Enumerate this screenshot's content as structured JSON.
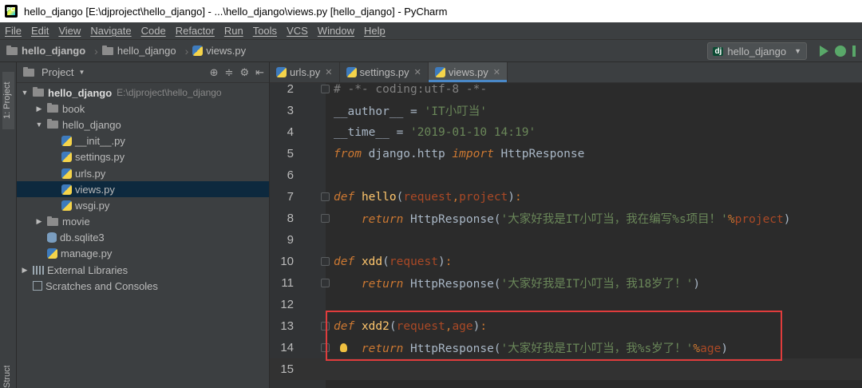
{
  "window": {
    "title": "hello_django [E:\\djproject\\hello_django] - ...\\hello_django\\views.py [hello_django] - PyCharm"
  },
  "menu": [
    "File",
    "Edit",
    "View",
    "Navigate",
    "Code",
    "Refactor",
    "Run",
    "Tools",
    "VCS",
    "Window",
    "Help"
  ],
  "breadcrumb": [
    "hello_django",
    "hello_django",
    "views.py"
  ],
  "run_config": {
    "label": "hello_django"
  },
  "toolwindows": {
    "project_tab": "1: Project",
    "structure_tab": "Structure"
  },
  "project_panel": {
    "title": "Project",
    "tree": [
      {
        "label": "hello_django",
        "hint": "E:\\djproject\\hello_django",
        "icon": "folder-icon",
        "arrow": "▼",
        "indent": 0,
        "bold": true
      },
      {
        "label": "book",
        "icon": "folder-icon",
        "arrow": "▶",
        "indent": 1
      },
      {
        "label": "hello_django",
        "icon": "folder-icon",
        "arrow": "▼",
        "indent": 1
      },
      {
        "label": "__init__.py",
        "icon": "python-file-icon",
        "arrow": "",
        "indent": 2
      },
      {
        "label": "settings.py",
        "icon": "python-file-icon",
        "arrow": "",
        "indent": 2
      },
      {
        "label": "urls.py",
        "icon": "python-file-icon",
        "arrow": "",
        "indent": 2
      },
      {
        "label": "views.py",
        "icon": "python-file-icon",
        "arrow": "",
        "indent": 2,
        "selected": true
      },
      {
        "label": "wsgi.py",
        "icon": "python-file-icon",
        "arrow": "",
        "indent": 2
      },
      {
        "label": "movie",
        "icon": "folder-icon",
        "arrow": "▶",
        "indent": 1
      },
      {
        "label": "db.sqlite3",
        "icon": "database-icon",
        "arrow": "",
        "indent": 1
      },
      {
        "label": "manage.py",
        "icon": "python-file-icon",
        "arrow": "",
        "indent": 1
      },
      {
        "label": "External Libraries",
        "icon": "library-icon",
        "arrow": "▶",
        "indent": 0
      },
      {
        "label": "Scratches and Consoles",
        "icon": "scratch-icon",
        "arrow": "",
        "indent": 0
      }
    ]
  },
  "editor": {
    "tabs": [
      {
        "label": "urls.py",
        "active": false
      },
      {
        "label": "settings.py",
        "active": false
      },
      {
        "label": "views.py",
        "active": true
      }
    ],
    "lines": [
      {
        "n": "2",
        "fold": true,
        "tokens": [
          {
            "t": "# -*- coding:utf-8 -*-",
            "c": "cm"
          }
        ]
      },
      {
        "n": "3",
        "tokens": [
          {
            "t": "__author__",
            "c": ""
          },
          {
            "t": " = ",
            "c": ""
          },
          {
            "t": "'IT小叮当'",
            "c": "str"
          }
        ]
      },
      {
        "n": "4",
        "tokens": [
          {
            "t": "__time__",
            "c": ""
          },
          {
            "t": " = ",
            "c": ""
          },
          {
            "t": "'2019-01-10 14:19'",
            "c": "str"
          }
        ]
      },
      {
        "n": "5",
        "tokens": [
          {
            "t": "from",
            "c": "kwi"
          },
          {
            "t": " django.http ",
            "c": ""
          },
          {
            "t": "import",
            "c": "kwi"
          },
          {
            "t": " HttpResponse",
            "c": ""
          }
        ]
      },
      {
        "n": "6",
        "tokens": []
      },
      {
        "n": "7",
        "fold": true,
        "tokens": [
          {
            "t": "def",
            "c": "kwi"
          },
          {
            "t": " ",
            "c": ""
          },
          {
            "t": "hello",
            "c": "fn"
          },
          {
            "t": "(",
            "c": ""
          },
          {
            "t": "request",
            "c": "prm"
          },
          {
            "t": ",",
            "c": "kw"
          },
          {
            "t": "project",
            "c": "prm"
          },
          {
            "t": ")",
            "c": ""
          },
          {
            "t": ":",
            "c": "kw"
          }
        ]
      },
      {
        "n": "8",
        "fold": true,
        "tokens": [
          {
            "t": "    ",
            "c": ""
          },
          {
            "t": "return",
            "c": "kwi"
          },
          {
            "t": " HttpResponse(",
            "c": ""
          },
          {
            "t": "'大家好我是IT小叮当，我在编写%s项目！'",
            "c": "str"
          },
          {
            "t": "%",
            "c": "kw"
          },
          {
            "t": "project",
            "c": "prm"
          },
          {
            "t": ")",
            "c": ""
          }
        ]
      },
      {
        "n": "9",
        "tokens": []
      },
      {
        "n": "10",
        "fold": true,
        "tokens": [
          {
            "t": "def",
            "c": "kwi"
          },
          {
            "t": " ",
            "c": ""
          },
          {
            "t": "xdd",
            "c": "fn"
          },
          {
            "t": "(",
            "c": ""
          },
          {
            "t": "request",
            "c": "prm"
          },
          {
            "t": ")",
            "c": ""
          },
          {
            "t": ":",
            "c": "kw"
          }
        ]
      },
      {
        "n": "11",
        "fold": true,
        "tokens": [
          {
            "t": "    ",
            "c": ""
          },
          {
            "t": "return",
            "c": "kwi"
          },
          {
            "t": " HttpResponse(",
            "c": ""
          },
          {
            "t": "'大家好我是IT小叮当，我18岁了！'",
            "c": "str"
          },
          {
            "t": ")",
            "c": ""
          }
        ]
      },
      {
        "n": "12",
        "tokens": []
      },
      {
        "n": "13",
        "fold": true,
        "tokens": [
          {
            "t": "def",
            "c": "kwi"
          },
          {
            "t": " ",
            "c": ""
          },
          {
            "t": "xdd2",
            "c": "fn"
          },
          {
            "t": "(",
            "c": ""
          },
          {
            "t": "request",
            "c": "prm"
          },
          {
            "t": ",",
            "c": "kw"
          },
          {
            "t": "age",
            "c": "prm"
          },
          {
            "t": ")",
            "c": ""
          },
          {
            "t": ":",
            "c": "kw"
          }
        ]
      },
      {
        "n": "14",
        "fold": true,
        "bulb": true,
        "tokens": [
          {
            "t": "    ",
            "c": ""
          },
          {
            "t": "return",
            "c": "kwi"
          },
          {
            "t": " HttpResponse(",
            "c": ""
          },
          {
            "t": "'大家好我是IT小叮当，我%s岁了！'",
            "c": "str"
          },
          {
            "t": "%",
            "c": "kw"
          },
          {
            "t": "age",
            "c": "prm"
          },
          {
            "t": ")",
            "c": ""
          }
        ]
      },
      {
        "n": "15",
        "current": true,
        "tokens": []
      }
    ]
  },
  "colors": {
    "selection": "#0d293e",
    "tab_underline": "#4a88c7",
    "annotation_box": "#e03c3c",
    "run_green": "#59a869"
  }
}
